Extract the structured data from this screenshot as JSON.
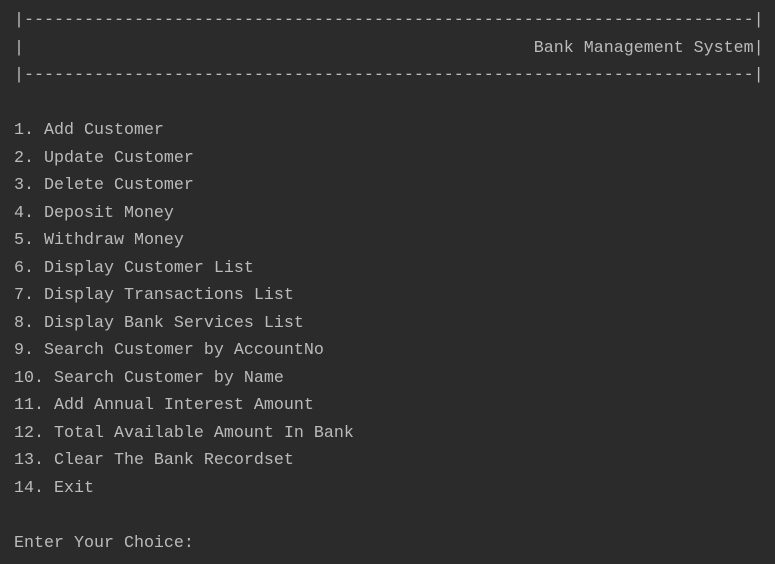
{
  "header": {
    "border_top": "|-------------------------------------------------------------------------|",
    "title_line": "|                                                   Bank Management System|",
    "border_bottom": "|-------------------------------------------------------------------------|"
  },
  "menu": {
    "items": [
      "1. Add Customer",
      "2. Update Customer",
      "3. Delete Customer",
      "4. Deposit Money",
      "5. Withdraw Money",
      "6. Display Customer List",
      "7. Display Transactions List",
      "8. Display Bank Services List",
      "9. Search Customer by AccountNo",
      "10. Search Customer by Name",
      "11. Add Annual Interest Amount",
      "12. Total Available Amount In Bank",
      "13. Clear The Bank Recordset",
      "14. Exit"
    ]
  },
  "prompt": "Enter Your Choice:"
}
